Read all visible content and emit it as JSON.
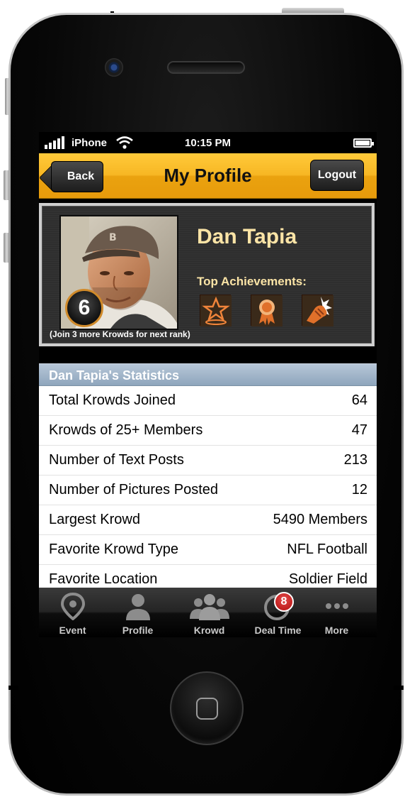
{
  "status_bar": {
    "carrier": "iPhone",
    "time": "10:15 PM"
  },
  "nav": {
    "back_label": "Back",
    "title": "My Profile",
    "logout_label": "Logout"
  },
  "profile": {
    "name": "Dan Tapia",
    "rank": "6",
    "rank_note": "(Join 3 more Krowds for next rank)",
    "achievements_label": "Top Achievements:",
    "achievements": [
      "star-trophy-icon",
      "ribbon-medal-icon",
      "fist-punch-icon"
    ]
  },
  "stats": {
    "header": "Dan Tapia's Statistics",
    "rows": [
      {
        "label": "Total Krowds Joined",
        "value": "64"
      },
      {
        "label": "Krowds of 25+ Members",
        "value": "47"
      },
      {
        "label": "Number of Text Posts",
        "value": "213"
      },
      {
        "label": "Number of Pictures Posted",
        "value": "12"
      },
      {
        "label": "Largest Krowd",
        "value": "5490 Members"
      },
      {
        "label": "Favorite Krowd Type",
        "value": "NFL Football"
      },
      {
        "label": "Favorite Location",
        "value": "Soldier Field"
      }
    ]
  },
  "tabs": [
    {
      "label": "Event",
      "icon": "map-pin-icon"
    },
    {
      "label": "Profile",
      "icon": "person-icon"
    },
    {
      "label": "Krowd",
      "icon": "group-icon"
    },
    {
      "label": "Deal Time",
      "icon": "clock-icon",
      "badge": "8"
    },
    {
      "label": "More",
      "icon": "more-dots-icon"
    }
  ],
  "colors": {
    "nav_gold": "#f7b724",
    "name_text": "#fbe4a6",
    "stats_header": "#9fb3c8",
    "achievement_orange": "#e0702a",
    "badge_red": "#c41a1a"
  }
}
